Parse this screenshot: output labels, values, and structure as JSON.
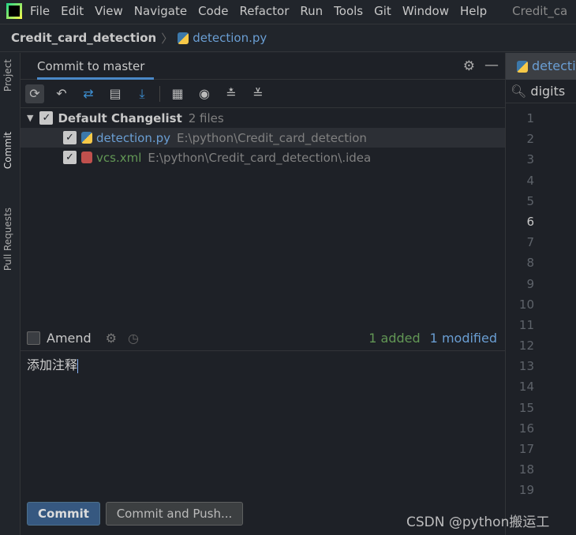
{
  "menu": {
    "items": [
      "File",
      "Edit",
      "View",
      "Navigate",
      "Code",
      "Refactor",
      "Run",
      "Tools",
      "Git",
      "Window",
      "Help"
    ],
    "window_title": "Credit_ca"
  },
  "breadcrumb": {
    "project": "Credit_card_detection",
    "file": "detection.py"
  },
  "side_tabs": {
    "project": "Project",
    "commit": "Commit",
    "pull_requests": "Pull Requests"
  },
  "commit_panel": {
    "title": "Commit to master",
    "toolbar": [
      "refresh-icon",
      "rollback-icon",
      "diff-icon",
      "shelve-icon",
      "update-icon",
      "group-by-icon",
      "view-options-icon",
      "expand-all-icon",
      "collapse-all-icon"
    ],
    "changelist": {
      "name": "Default Changelist",
      "count": "2 files",
      "checked": true,
      "files": [
        {
          "name": "detection.py",
          "path": "E:\\python\\Credit_card_detection",
          "status": "modified",
          "color": "#6a9ed3",
          "checked": true
        },
        {
          "name": "vcs.xml",
          "path": "E:\\python\\Credit_card_detection\\.idea",
          "status": "added",
          "color": "#629755",
          "checked": true
        }
      ]
    },
    "amend_label": "Amend",
    "amend_checked": false,
    "added": "1 added",
    "modified": "1 modified",
    "message": "添加注释",
    "commit_button": "Commit",
    "commit_push_button": "Commit and Push..."
  },
  "editor": {
    "tab": "detection.py",
    "search": "digits",
    "line_numbers": [
      "1",
      "2",
      "3",
      "4",
      "5",
      "6",
      "7",
      "8",
      "9",
      "10",
      "11",
      "12",
      "13",
      "14",
      "15",
      "16",
      "17",
      "18",
      "19"
    ],
    "current_line": "6"
  },
  "watermark": "CSDN @python搬运工"
}
